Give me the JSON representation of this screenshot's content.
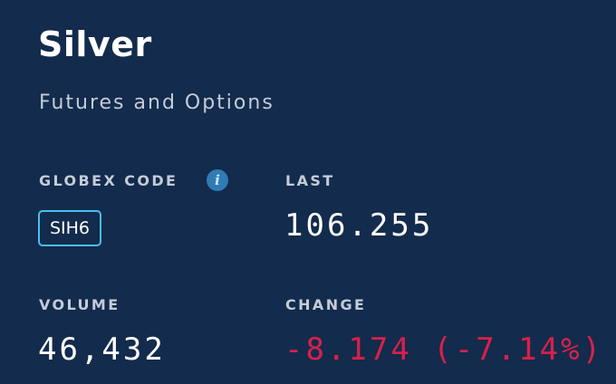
{
  "header": {
    "title": "Silver",
    "subtitle": "Futures and Options"
  },
  "globex": {
    "label": "GLOBEX CODE",
    "info_icon_glyph": "i",
    "code": "SIH6"
  },
  "last": {
    "label": "LAST",
    "value": "106.255"
  },
  "volume": {
    "label": "VOLUME",
    "value": "46,432"
  },
  "change": {
    "label": "CHANGE",
    "value": "-8.174 (-7.14%)",
    "color": "#d8204b"
  },
  "colors": {
    "background": "#132b4c",
    "info_icon": "#2f7bb5",
    "badge_border": "#47bfee"
  }
}
